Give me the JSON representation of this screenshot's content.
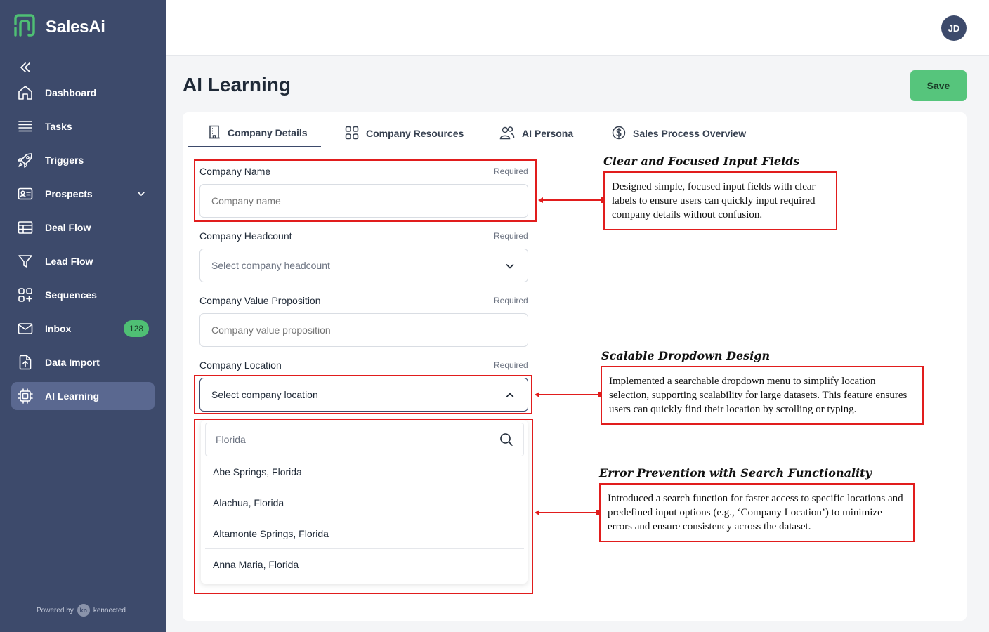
{
  "app": {
    "name": "SalesAi"
  },
  "sidebar": {
    "items": [
      {
        "label": "Dashboard",
        "icon": "home-icon"
      },
      {
        "label": "Tasks",
        "icon": "list-icon"
      },
      {
        "label": "Triggers",
        "icon": "rocket-icon"
      },
      {
        "label": "Prospects",
        "icon": "contact-card-icon",
        "has_chevron": true
      },
      {
        "label": "Deal Flow",
        "icon": "table-icon"
      },
      {
        "label": "Lead Flow",
        "icon": "funnel-icon"
      },
      {
        "label": "Sequences",
        "icon": "grid-plus-icon"
      },
      {
        "label": "Inbox",
        "icon": "mail-icon",
        "badge": "128"
      },
      {
        "label": "Data Import",
        "icon": "file-upload-icon"
      },
      {
        "label": "AI Learning",
        "icon": "chip-icon",
        "active": true
      }
    ],
    "powered_by": "Powered by",
    "powered_brand": "kennected",
    "powered_logo": "kn"
  },
  "user": {
    "initials": "JD"
  },
  "page": {
    "title": "AI Learning",
    "save_label": "Save"
  },
  "tabs": [
    {
      "label": "Company Details",
      "icon": "building-icon",
      "active": true
    },
    {
      "label": "Company Resources",
      "icon": "grid-icon"
    },
    {
      "label": "AI Persona",
      "icon": "users-icon"
    },
    {
      "label": "Sales Process Overview",
      "icon": "dollar-circle-icon"
    }
  ],
  "form": {
    "required_label": "Required",
    "company_name": {
      "label": "Company Name",
      "placeholder": "Company name"
    },
    "headcount": {
      "label": "Company Headcount",
      "placeholder": "Select company headcount"
    },
    "value_prop": {
      "label": "Company Value Proposition",
      "placeholder": "Company value proposition"
    },
    "location": {
      "label": "Company Location",
      "placeholder": "Select company location"
    }
  },
  "dropdown": {
    "search_value": "Florida",
    "options": [
      "Abe Springs, Florida",
      "Alachua, Florida",
      "Altamonte Springs, Florida",
      "Anna Maria, Florida"
    ]
  },
  "annotations": [
    {
      "title": "Clear and Focused Input Fields",
      "text": "Designed simple, focused input fields with clear labels to ensure users can quickly input required company details without confusion."
    },
    {
      "title": "Scalable Dropdown Design",
      "text": "Implemented a searchable dropdown menu to simplify location selection, supporting scalability for large datasets. This feature ensures users can quickly find their location by scrolling or typing."
    },
    {
      "title": "Error Prevention with Search Functionality",
      "text": "Introduced a search function for faster access to specific locations and predefined input options (e.g., ‘Company Location’) to minimize errors and ensure consistency across the dataset."
    }
  ],
  "colors": {
    "sidebar": "#3d4a6b",
    "sidebar_active": "#5a6890",
    "accent_green": "#56c57c",
    "annotation_red": "#e11d1d"
  }
}
